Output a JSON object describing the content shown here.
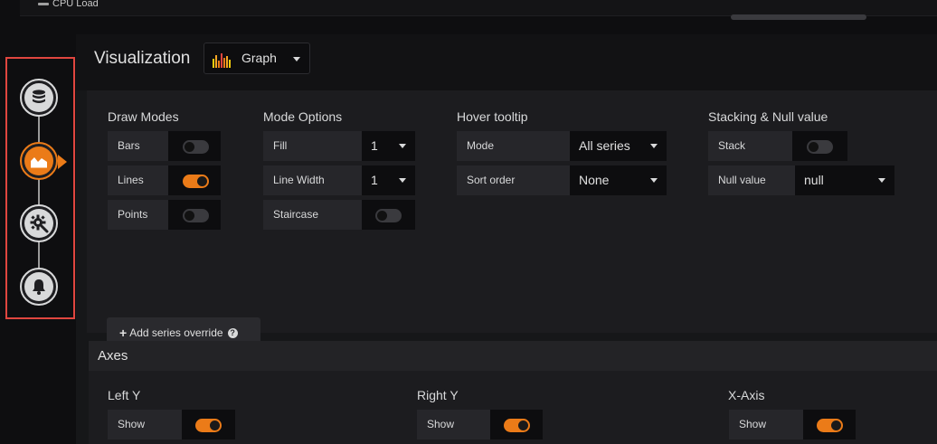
{
  "top": {
    "legend_label": "CPU Load"
  },
  "rail": {
    "items": [
      {
        "name": "queries",
        "icon": "database-icon"
      },
      {
        "name": "visualization",
        "icon": "graph-icon",
        "active": true
      },
      {
        "name": "general",
        "icon": "gear-icon"
      },
      {
        "name": "alert",
        "icon": "bell-icon"
      }
    ]
  },
  "visualization": {
    "title": "Visualization",
    "selected": "Graph"
  },
  "draw_modes": {
    "title": "Draw Modes",
    "bars": "Bars",
    "bars_on": false,
    "lines": "Lines",
    "lines_on": true,
    "points": "Points",
    "points_on": false
  },
  "mode_options": {
    "title": "Mode Options",
    "fill": "Fill",
    "fill_value": "1",
    "line_width": "Line Width",
    "line_width_value": "1",
    "staircase": "Staircase",
    "staircase_on": false
  },
  "hover_tooltip": {
    "title": "Hover tooltip",
    "mode": "Mode",
    "mode_value": "All series",
    "sort_order": "Sort order",
    "sort_order_value": "None"
  },
  "stacking": {
    "title": "Stacking & Null value",
    "stack": "Stack",
    "stack_on": false,
    "null_value": "Null value",
    "null_value_value": "null"
  },
  "add_override": {
    "label": "Add series override"
  },
  "axes": {
    "title": "Axes",
    "left_y": {
      "title": "Left Y",
      "show": "Show",
      "show_on": true
    },
    "right_y": {
      "title": "Right Y",
      "show": "Show",
      "show_on": true
    },
    "x_axis": {
      "title": "X-Axis",
      "show": "Show",
      "show_on": true
    }
  },
  "colors": {
    "accent": "#eb7b18",
    "highlight_border": "#e0463f"
  }
}
